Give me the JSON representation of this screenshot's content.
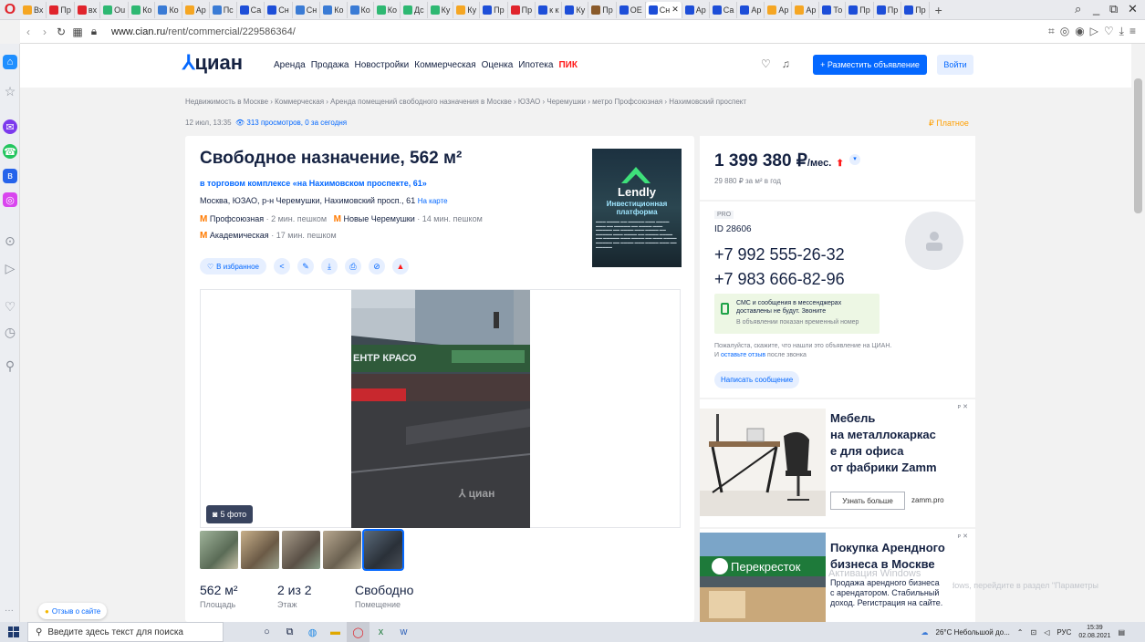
{
  "browser": {
    "tabs": [
      "Вх",
      "Пр",
      "вх",
      "Ou",
      "Ко",
      "Ко",
      "Ар",
      "Пс",
      "Са",
      "Сн",
      "Сн",
      "Ко",
      "Ко",
      "Ко",
      "Дс",
      "Ку",
      "Ку",
      "Пр",
      "Пр",
      "к к",
      "Ку",
      "Пр",
      "ОЕ",
      "Сн",
      "Ар",
      "Са",
      "Ар",
      "Ар",
      "Ар",
      "То",
      "Пр",
      "Пр",
      "Пр"
    ],
    "url_domain": "www.cian.ru",
    "url_path": "/rent/commercial/229586364/"
  },
  "header": {
    "logo": "циан",
    "nav": [
      "Аренда",
      "Продажа",
      "Новостройки",
      "Коммерческая",
      "Оценка",
      "Ипотека"
    ],
    "nav_pik": "ПИК",
    "post_button": "+ Разместить объявление",
    "login_button": "Войти"
  },
  "breadcrumbs": "Недвижимость в Москве  ›  Коммерческая  ›  Аренда помещений свободного назначения в Москве  ›  ЮЗАО  ›  Черемушки  ›  метро Профсоюзная  ›  Нахимовский проспект",
  "meta": {
    "date": "12 июл, 13:35",
    "views": "313 просмотров, 0 за сегодня",
    "paid": "₽ Платное"
  },
  "listing": {
    "title": "Свободное назначение, 562 м²",
    "complex": "в торговом комплексе «на Нахимовском проспекте, 61»",
    "address": "Москва, ЮЗАО, р-н Черемушки, Нахимовский просп., 61",
    "on_map": "На карте",
    "metro": [
      {
        "name": "Профсоюзная",
        "time": "· 2 мин. пешком"
      },
      {
        "name": "Новые Черемушки",
        "time": "· 14 мин. пешком"
      },
      {
        "name": "Академическая",
        "time": "· 17 мин. пешком"
      }
    ],
    "favorite_button": "В избранное",
    "photo_count": "5 фото",
    "photo_watermark": "циан",
    "photo_storefront_text": "ЕНТР КРАСО",
    "specs": [
      {
        "value": "562 м²",
        "label": "Площадь"
      },
      {
        "value": "2 из 2",
        "label": "Этаж"
      },
      {
        "value": "Свободно",
        "label": "Помещение"
      }
    ]
  },
  "lendly_ad": {
    "brand": "Lendly",
    "subtitle_1": "Инвестиционная",
    "subtitle_2": "платформа"
  },
  "price": {
    "value": "1 399 380 ₽",
    "unit": "/мес.",
    "per_meter": "29 880 ₽ за м² в год"
  },
  "contact": {
    "badge": "PRO",
    "id": "ID 28606",
    "phones": [
      "+7 992 555-26-32",
      "+7 983 666-82-96"
    ],
    "sms_notice": "СМС и сообщения в мессенджерах доставлены не будут. Звоните",
    "temp_number": "В объявлении показан временный номер",
    "ask_text_1": "Пожалуйста, скажите, что нашли это объявление на ЦИАН. И",
    "ask_link": "оставьте отзыв",
    "ask_text_2": "после звонка",
    "message_button": "Написать сообщение"
  },
  "ads": [
    {
      "headline": [
        "Мебель",
        "на металлокаркас",
        "е для офиса",
        "от фабрики Zamm"
      ],
      "button": "Узнать больше",
      "domain": "zamm.pro"
    },
    {
      "headline": [
        "Покупка Арендного",
        "бизнеса в Москве"
      ],
      "body": [
        "Продажа арендного бизнеса",
        "с арендатором. Стабильный",
        "доход. Регистрация на сайте."
      ],
      "brand": "Перекресток"
    }
  ],
  "ad_close": "ᴘ ✕",
  "windows_watermark": {
    "line1": "Активация Windows",
    "line2": "Чтобы активировать Windows, перейдите в раздел \"Параметры\"."
  },
  "feedback_button": "Отзыв о сайте",
  "taskbar": {
    "search_placeholder": "Введите здесь текст для поиска",
    "weather": "26°C  Небольшой до...",
    "lang": "РУС",
    "time": "15:39",
    "date": "02.08.2021"
  },
  "colors": {
    "accent": "#0468ff",
    "metro": "#ff7a00",
    "pik": "#ff1a1a"
  }
}
